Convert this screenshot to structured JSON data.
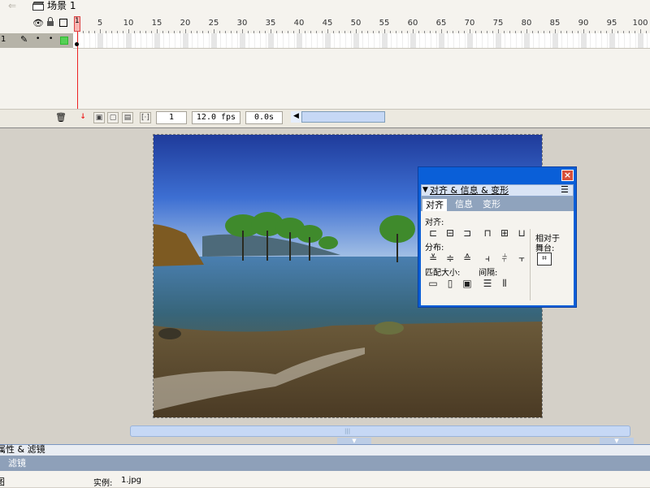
{
  "scene_bar": {
    "back_icon": "back-arrow-icon",
    "scene_icon": "clapperboard-icon",
    "scene_label": "场景 1"
  },
  "timeline": {
    "layer_header_icons": [
      "eye-icon",
      "lock-icon",
      "outline-square-icon"
    ],
    "ruler_labels": [
      "1",
      "5",
      "10",
      "15",
      "20",
      "25",
      "30",
      "35",
      "40",
      "45",
      "50",
      "55",
      "60",
      "65",
      "70",
      "75",
      "80",
      "85",
      "90",
      "95",
      "100"
    ],
    "layer": {
      "name": "1",
      "icons": [
        "pencil-icon",
        "visibility-dot-icon",
        "lock-dot-icon",
        "green-outline-square-icon"
      ],
      "outline_color": "#2eb82e"
    },
    "current_frame": "1",
    "frame_rate": "12.0 fps",
    "elapsed_time": "0.0s",
    "bottom_icons": [
      "trash-icon",
      "center-frame-icon",
      "onion-skin-icon",
      "onion-skin-outlines-icon",
      "edit-multiple-frames-icon",
      "modify-onion-markers-icon"
    ]
  },
  "stage": {
    "image_alt": "lake shore photo with trees standing in water"
  },
  "align_panel": {
    "title": "对齐 & 信息 & 变形",
    "tabs": [
      "对齐",
      "信息",
      "变形"
    ],
    "active_tab": "对齐",
    "section_align": "对齐:",
    "section_distribute": "分布:",
    "section_match_size": "匹配大小:",
    "section_spacing": "间隔:",
    "relative_to_label_1": "相对于",
    "relative_to_label_2": "舞台:",
    "close_icon": "close-icon",
    "menu_icon": "panel-menu-icon"
  },
  "bottom_panel": {
    "header_label": "属性 & 滤镜",
    "tab_filter": "滤镜",
    "left_glyph": "图",
    "instance_label": "实例:",
    "instance_value": "1.jpg"
  },
  "colors": {
    "panel_blue": "#0a5fd8",
    "playhead_red": "#e22222",
    "scroll_blue": "#c6d8f5"
  }
}
